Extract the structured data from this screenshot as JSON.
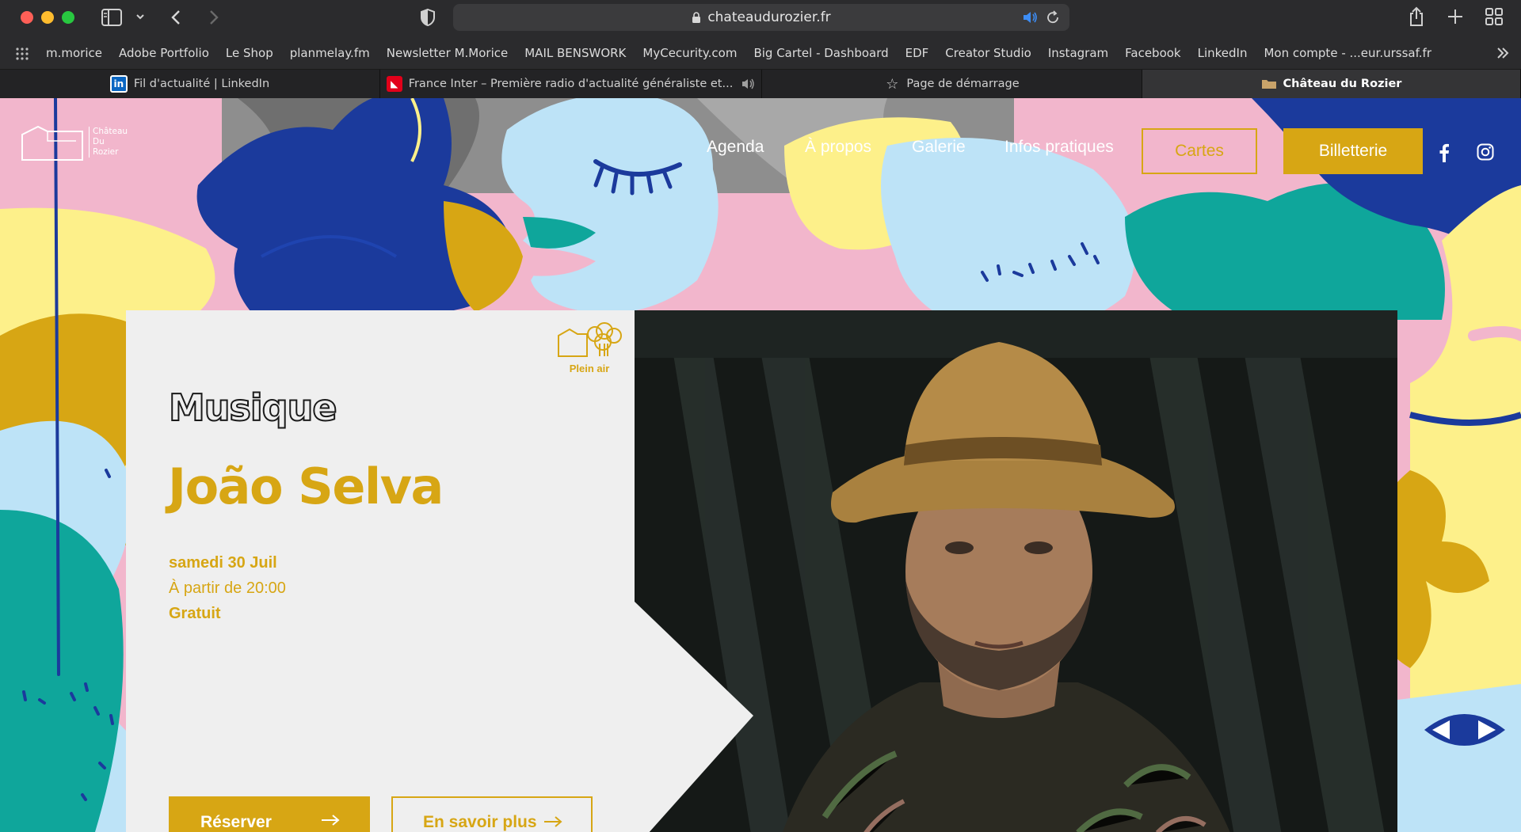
{
  "browser": {
    "url": "chateaudurozier.fr",
    "bookmarks": [
      "m.morice",
      "Adobe Portfolio",
      "Le Shop",
      "planmelay.fm",
      "Newsletter M.Morice",
      "MAIL BENSWORK",
      "MyCecurity.com",
      "Big Cartel - Dashboard",
      "EDF",
      "Creator Studio",
      "Instagram",
      "Facebook",
      "LinkedIn",
      "Mon compte - ...eur.urssaf.fr"
    ],
    "tabs": [
      {
        "label": "Fil d'actualité | LinkedIn",
        "icon": "linkedin-icon"
      },
      {
        "label": "France Inter – Première radio d'actualité généraliste et...",
        "icon": "france-inter-icon"
      },
      {
        "label": "Page de démarrage",
        "icon": "star-icon"
      },
      {
        "label": "Château du Rozier",
        "icon": "folder-icon"
      }
    ]
  },
  "site": {
    "logo": {
      "line1": "Château",
      "line2": "Du",
      "line3": "Rozier"
    },
    "nav": [
      "Agenda",
      "À propos",
      "Galerie",
      "Infos pratiques"
    ],
    "cartes_label": "Cartes",
    "billetterie_label": "Billetterie",
    "social": [
      "facebook-icon",
      "instagram-icon"
    ],
    "colors": {
      "accent": "#d7a614",
      "navy": "#1b3a9c",
      "sky": "#bde3f7",
      "yellow": "#fdf08a",
      "pink": "#f2b6cc",
      "teal": "#0fa69b"
    }
  },
  "event": {
    "badge": "Plein air",
    "category": "Musique",
    "title": "João Selva",
    "date": "samedi 30 Juil",
    "time": "À partir de 20:00",
    "price": "Gratuit",
    "reserve_label": "Réserver",
    "more_label": "En savoir plus"
  }
}
